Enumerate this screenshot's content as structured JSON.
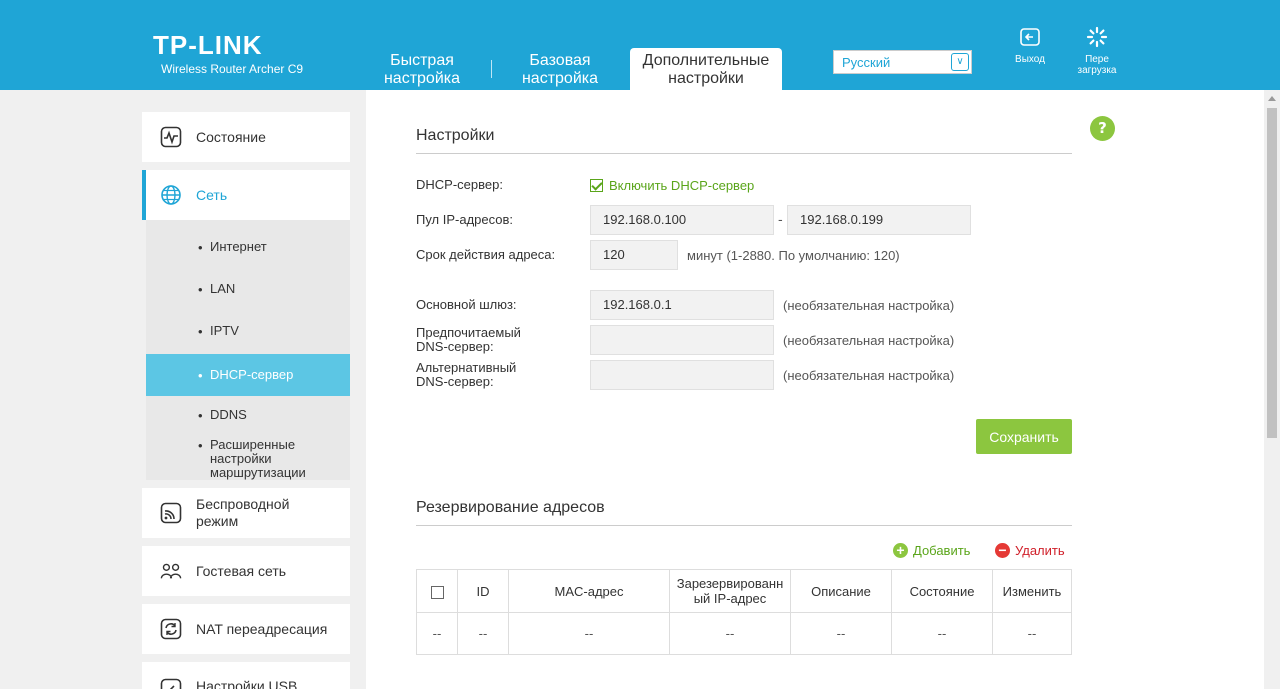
{
  "header": {
    "logo": "TP-LINK",
    "model": "Wireless Router Archer C9",
    "tabs": [
      {
        "label_line1": "Быстрая",
        "label_line2": "настройка"
      },
      {
        "label_line1": "Базовая",
        "label_line2": "настройка"
      },
      {
        "label_line1": "Дополнительные",
        "label_line2": "настройки"
      }
    ],
    "language": "Русский",
    "logout_label": "Выход",
    "reboot_line1": "Пере",
    "reboot_line2": "загрузка"
  },
  "sidebar": {
    "status": "Состояние",
    "network": "Сеть",
    "network_sub": [
      {
        "label": "Интернет"
      },
      {
        "label": "LAN"
      },
      {
        "label": "IPTV"
      },
      {
        "label": "DHCP-сервер"
      },
      {
        "label": "DDNS"
      },
      {
        "label_line1": "Расширенные",
        "label_line2": "настройки",
        "label_line3": "маршрутизации"
      }
    ],
    "wireless_line1": "Беспроводной",
    "wireless_line2": "режим",
    "guest": "Гостевая сеть",
    "nat": "NAT переадресация",
    "usb": "Настройки USB"
  },
  "settings": {
    "title": "Настройки",
    "dhcp_label": "DHCP-сервер:",
    "dhcp_checkbox": "Включить DHCP-сервер",
    "pool_label": "Пул IP-адресов:",
    "pool_start": "192.168.0.100",
    "pool_sep": "-",
    "pool_end": "192.168.0.199",
    "lease_label": "Срок действия адреса:",
    "lease_value": "120",
    "lease_note": "минут (1-2880. По умолчанию: 120)",
    "gateway_label": "Основной шлюз:",
    "gateway_value": "192.168.0.1",
    "optional_note": "(необязательная настройка)",
    "dns1_label_line1": "Предпочитаемый",
    "dns1_label_line2": "DNS-сервер:",
    "dns1_value": "",
    "dns2_label_line1": "Альтернативный",
    "dns2_label_line2": "DNS-сервер:",
    "dns2_value": "",
    "save_label": "Сохранить",
    "help": "?"
  },
  "reservation": {
    "title": "Резервирование адресов",
    "add_label": "Добавить",
    "delete_label": "Удалить",
    "columns": {
      "id": "ID",
      "mac": "MAC-адрес",
      "ip_line1": "Зарезервированн",
      "ip_line2": "ый IP-адрес",
      "desc": "Описание",
      "state": "Состояние",
      "edit": "Изменить"
    },
    "row": [
      "--",
      "--",
      "--",
      "--",
      "--",
      "--",
      "--"
    ]
  },
  "colors": {
    "header_blue": "#1fa5d6",
    "active_sub": "#5cc6e4",
    "green": "#8cc63f",
    "red": "#e53935"
  }
}
